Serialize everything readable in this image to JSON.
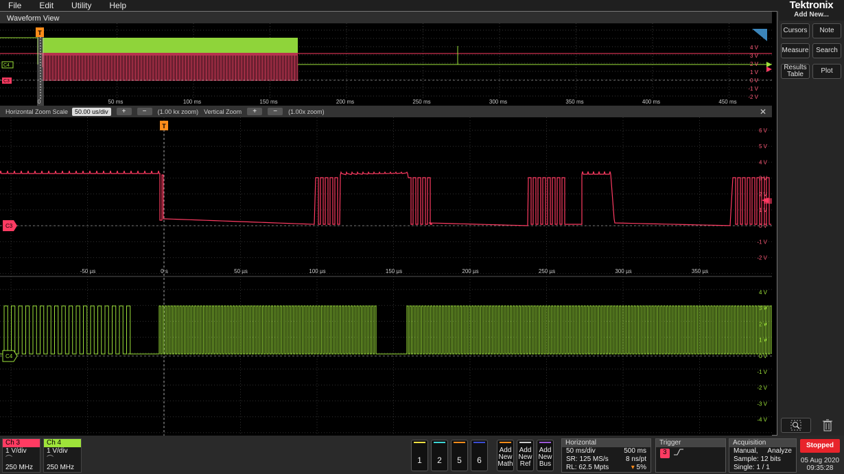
{
  "menu": [
    "File",
    "Edit",
    "Utility",
    "Help"
  ],
  "brand": {
    "logo": "Tektronix",
    "add_new": "Add New..."
  },
  "right_panel": {
    "cursors": "Cursors",
    "note": "Note",
    "measure": "Measure",
    "search": "Search",
    "results_table_1": "Results",
    "results_table_2": "Table",
    "plot": "Plot"
  },
  "waveform_view": {
    "title": "Waveform View"
  },
  "overview": {
    "trigger_marker": "T",
    "ticks": [
      "0",
      "50 ms",
      "100 ms",
      "150 ms",
      "200 ms",
      "250 ms",
      "300 ms",
      "350 ms",
      "400 ms",
      "450 ms"
    ],
    "volt_labels": [
      "4 V",
      "3 V",
      "2 V",
      "1 V",
      "0 V",
      "-1 V",
      "-2 V"
    ],
    "ch_labels": {
      "c4": "C4",
      "c3": "C3"
    }
  },
  "zoom_bar": {
    "hzoom_label": "Horizontal Zoom Scale",
    "hzoom_value": "50.00 us/div",
    "plus": "+",
    "minus": "−",
    "hzoom_text": "(1.00 kx zoom)",
    "vzoom_label": "Vertical Zoom",
    "vzoom_text": "(1.00x zoom)",
    "close": "✕"
  },
  "main": {
    "trigger_marker": "T",
    "c3_label": "C3",
    "c4_label": "C4",
    "c3_volts": [
      "6 V",
      "5 V",
      "4 V",
      "3 V",
      "2 V",
      "1 V",
      "0 V",
      "-1 V",
      "-2 V"
    ],
    "time_ticks": [
      "-50 µs",
      "0 s",
      "50 µs",
      "100 µs",
      "150 µs",
      "200 µs",
      "250 µs",
      "300 µs",
      "350 µs"
    ],
    "c4_volts": [
      "4 V",
      "3 V",
      "2 V",
      "1 V",
      "0 V",
      "-1 V",
      "-2 V",
      "-3 V",
      "-4 V"
    ]
  },
  "bottom": {
    "ch3": {
      "name": "Ch 3",
      "scale": "1 V/div",
      "bw": "250 MHz"
    },
    "ch4": {
      "name": "Ch 4",
      "scale": "1 V/div",
      "bw": "250 MHz"
    },
    "num_buttons": [
      "1",
      "2",
      "5",
      "6"
    ],
    "add_math": [
      "Add",
      "New",
      "Math"
    ],
    "add_ref": [
      "Add",
      "New",
      "Ref"
    ],
    "add_bus": [
      "Add",
      "New",
      "Bus"
    ],
    "horizontal": {
      "title": "Horizontal",
      "scale": "50 ms/div",
      "pos": "500 ms",
      "sr": "SR: 125 MS/s",
      "pt": "8 ns/pt",
      "rl": "RL: 62.5 Mpts",
      "pct": "5%"
    },
    "trigger": {
      "title": "Trigger",
      "source": "3"
    },
    "acquisition": {
      "title": "Acquisition",
      "mode": "Manual,",
      "analyze": "Analyze",
      "sample": "Sample: 12 bits",
      "single": "Single: 1 / 1"
    },
    "stopped": "Stopped",
    "date": "05 Aug 2020",
    "time": "09:35:28"
  },
  "colors": {
    "c3": "#ff3b62",
    "c4": "#9ee33a",
    "trigger": "#ff8c1a",
    "stopped": "#e8242b"
  }
}
